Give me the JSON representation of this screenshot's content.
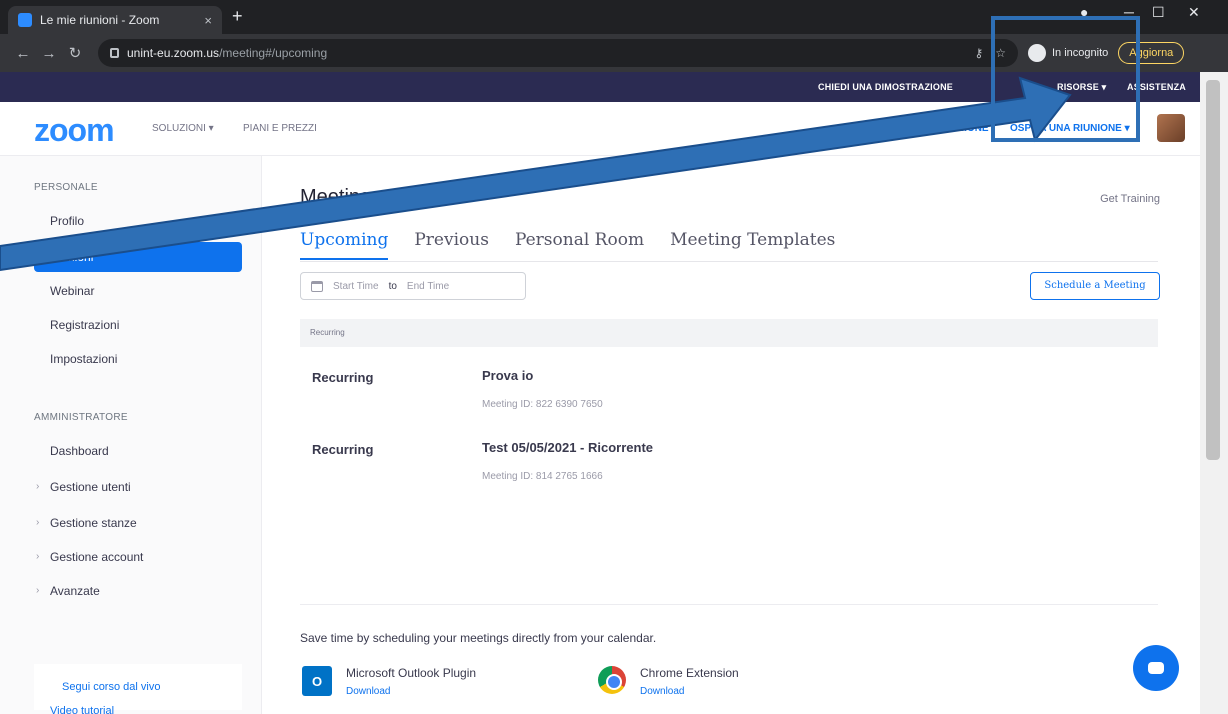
{
  "browser": {
    "tab_title": "Le mie riunioni - Zoom",
    "tab_close": "×",
    "new_tab": "+",
    "url_host": "unint-eu.zoom.us",
    "url_path": "/meeting#/upcoming",
    "incognito_label": "In incognito",
    "update_label": "Aggiorna"
  },
  "topstrip": {
    "demo": "CHIEDI UNA DIMOSTRAZIONE",
    "resources": "RISORSE ▾",
    "support": "ASSISTENZA"
  },
  "header": {
    "logo": "zoom",
    "solutions": "SOLUZIONI ▾",
    "plans": "PIANI E PREZZI",
    "join": "ENTRA IN UNA RIUNIONE",
    "host": "OSPITA UNA RIUNIONE ▾"
  },
  "sidebar": {
    "personal_heading": "PERSONALE",
    "personal_items": [
      "Profilo",
      "Riunioni",
      "Webinar",
      "Registrazioni",
      "Impostazioni"
    ],
    "admin_heading": "AMMINISTRATORE",
    "admin_items": [
      "Dashboard",
      "Gestione utenti",
      "Gestione stanze",
      "Gestione account",
      "Avanzate"
    ],
    "live_course": "Segui corso dal vivo",
    "video_tutorials": "Video tutorial"
  },
  "main": {
    "title": "Meetings",
    "get_training": "Get Training",
    "tabs": [
      "Upcoming",
      "Previous",
      "Personal Room",
      "Meeting Templates"
    ],
    "start_time": "Start Time",
    "to": "to",
    "end_time": "End Time",
    "schedule_button": "Schedule a Meeting",
    "group_label": "Recurring",
    "meetings": [
      {
        "type": "Recurring",
        "title": "Prova io",
        "id": "Meeting ID: 822 6390 7650"
      },
      {
        "type": "Recurring",
        "title": "Test 05/05/2021 - Ricorrente",
        "id": "Meeting ID: 814 2765 1666"
      }
    ],
    "save_time": "Save time by scheduling your meetings directly from your calendar.",
    "plugins": [
      {
        "name": "Microsoft Outlook Plugin",
        "link": "Download"
      },
      {
        "name": "Chrome Extension",
        "link": "Download"
      }
    ]
  },
  "colors": {
    "zoom_blue": "#2d8cff",
    "active_blue": "#0e72ed",
    "annotation_blue": "#2e6fb5",
    "chrome_dark": "#202124"
  },
  "icons": {
    "tab_favicon": "zoom-favicon-icon",
    "lock": "lock-icon",
    "calendar": "calendar-icon",
    "chat": "chat-bubble-icon",
    "outlook": "outlook-icon",
    "chrome": "chrome-icon"
  }
}
